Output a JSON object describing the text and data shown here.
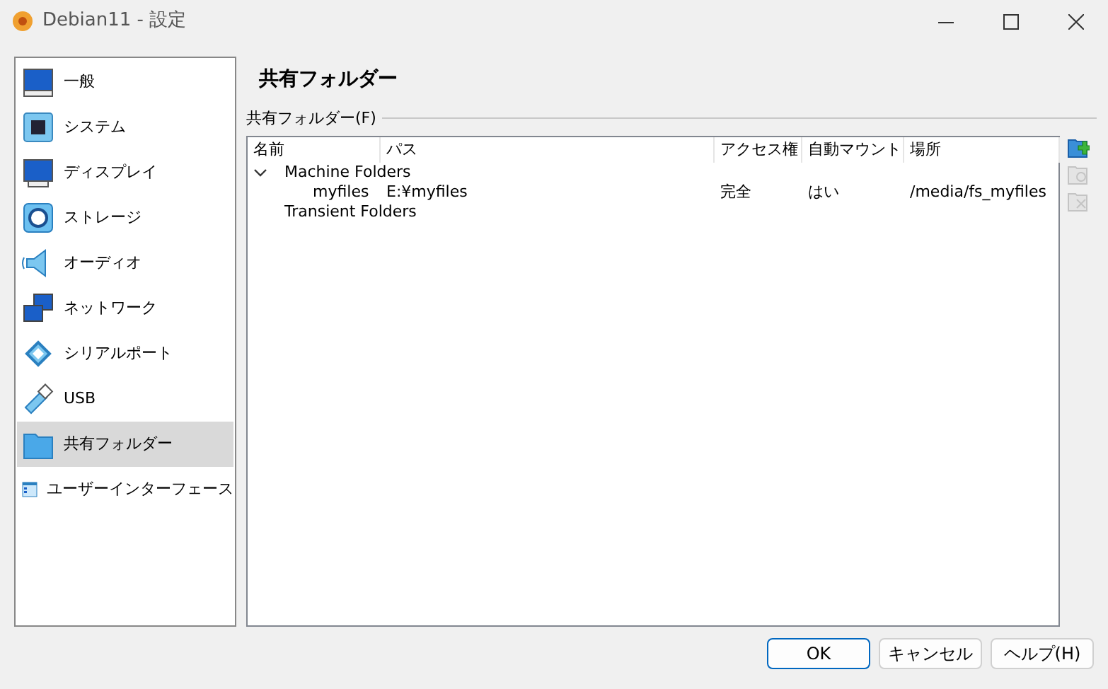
{
  "window": {
    "title": "Debian11 - 設定"
  },
  "sidebar": {
    "items": [
      {
        "label": "一般",
        "selected": false
      },
      {
        "label": "システム",
        "selected": false
      },
      {
        "label": "ディスプレイ",
        "selected": false
      },
      {
        "label": "ストレージ",
        "selected": false
      },
      {
        "label": "オーディオ",
        "selected": false
      },
      {
        "label": "ネットワーク",
        "selected": false
      },
      {
        "label": "シリアルポート",
        "selected": false
      },
      {
        "label": "USB",
        "selected": false
      },
      {
        "label": "共有フォルダー",
        "selected": true
      },
      {
        "label": "ユーザーインターフェース",
        "selected": false
      }
    ]
  },
  "page_title": "共有フォルダー",
  "group_label": "共有フォルダー(F)",
  "table": {
    "columns": [
      "名前",
      "パス",
      "アクセス権",
      "自動マウント",
      "場所"
    ],
    "rows": [
      {
        "label": "Machine Folders",
        "expanded": true,
        "children": [
          {
            "cells": [
              "myfiles",
              "E:¥myfiles",
              "完全",
              "はい",
              "/media/fs_myfiles"
            ]
          }
        ]
      },
      {
        "label": "Transient Folders"
      }
    ]
  },
  "side_tools": [
    {
      "disabled": false
    },
    {
      "disabled": true
    },
    {
      "disabled": true
    }
  ],
  "buttons": [
    {
      "label": "OK",
      "default": true
    },
    {
      "label": "キャンセル",
      "default": false
    },
    {
      "label": "ヘルプ(H)",
      "default": false
    }
  ]
}
